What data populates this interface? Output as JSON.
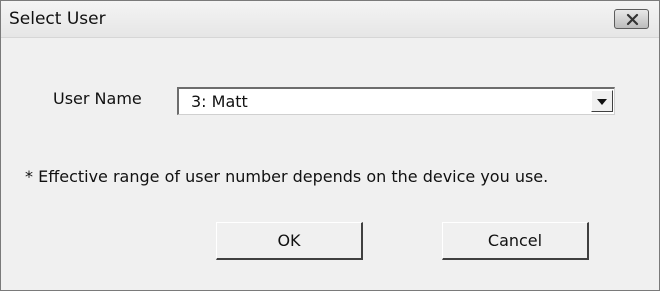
{
  "window": {
    "title": "Select User"
  },
  "form": {
    "user_name_label": "User Name",
    "user_name_value": "3: Matt",
    "note": "* Effective range of user number depends on the device you use."
  },
  "buttons": {
    "ok_label": "OK",
    "cancel_label": "Cancel"
  },
  "icons": {
    "close": "close-icon",
    "dropdown": "chevron-down-icon"
  },
  "colors": {
    "dialog_background": "#f0f0f0",
    "text": "#111111",
    "field_background": "#ffffff"
  }
}
